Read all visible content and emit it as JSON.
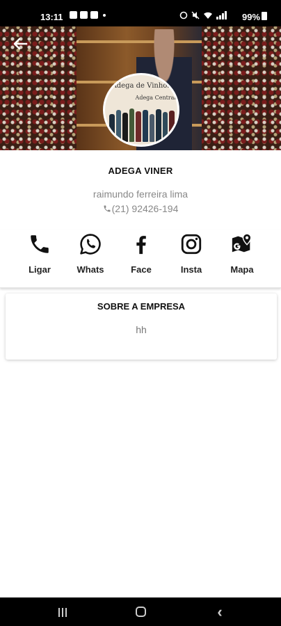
{
  "status_bar": {
    "time": "13:11",
    "battery": "99%"
  },
  "hero": {
    "logo_title": "Adega de Vinhos",
    "logo_subtitle": "Adega Central"
  },
  "profile": {
    "name": "ADEGA VINER",
    "owner": "raimundo ferreira lima",
    "phone": "(21) 92426-194"
  },
  "actions": [
    {
      "label": "Ligar",
      "icon": "phone-icon"
    },
    {
      "label": "Whats",
      "icon": "whatsapp-icon"
    },
    {
      "label": "Face",
      "icon": "facebook-icon"
    },
    {
      "label": "Insta",
      "icon": "instagram-icon"
    },
    {
      "label": "Mapa",
      "icon": "map-icon"
    }
  ],
  "about": {
    "title": "SOBRE A EMPRESA",
    "text": "hh"
  },
  "nav": {
    "back_glyph": "‹"
  }
}
